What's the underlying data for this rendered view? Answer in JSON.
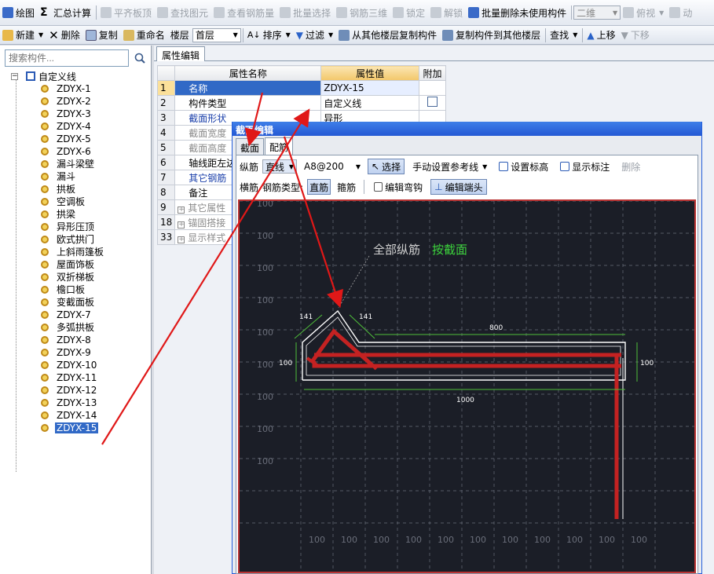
{
  "toolbar1": [
    {
      "label": "绘图",
      "icon": "draw-icon",
      "disabled": false
    },
    {
      "label": "汇总计算",
      "icon": "sigma-icon",
      "disabled": false
    },
    {
      "label": "平齐板顶",
      "icon": "align-top-icon",
      "disabled": true
    },
    {
      "label": "查找图元",
      "icon": "find-element-icon",
      "disabled": true
    },
    {
      "label": "查看钢筋量",
      "icon": "rebar-quantity-icon",
      "disabled": true
    },
    {
      "label": "批量选择",
      "icon": "batch-select-icon",
      "disabled": true
    },
    {
      "label": "钢筋三维",
      "icon": "rebar-3d-icon",
      "disabled": true
    },
    {
      "label": "锁定",
      "icon": "lock-icon",
      "disabled": true
    },
    {
      "label": "解锁",
      "icon": "unlock-icon",
      "disabled": true
    },
    {
      "label": "批量删除未使用构件",
      "icon": "batch-delete-icon",
      "disabled": false
    }
  ],
  "view_combo": "二维",
  "view_toolbar": [
    {
      "label": "俯视",
      "icon": "top-view-icon"
    },
    {
      "label": "动",
      "icon": "orbit-icon"
    }
  ],
  "toolbar2": {
    "new": "新建",
    "delete": "删除",
    "copy": "复制",
    "rename": "重命名",
    "floor_label": "楼层",
    "floor_value": "首层",
    "sort": "排序",
    "filter": "过滤",
    "copy_from": "从其他楼层复制构件",
    "copy_to": "复制构件到其他楼层",
    "find": "查找",
    "move_up": "上移",
    "move_down": "下移"
  },
  "search_placeholder": "搜索构件...",
  "tree": {
    "root": "自定义线",
    "items": [
      "ZDYX-1",
      "ZDYX-2",
      "ZDYX-3",
      "ZDYX-4",
      "ZDYX-5",
      "ZDYX-6",
      "漏斗梁壁",
      "漏斗",
      "拱板",
      "空调板",
      "拱梁",
      "异形压顶",
      "欧式拱门",
      "上斜雨篷板",
      "屋面饰板",
      "双折梯板",
      "檐口板",
      "变截面板",
      "ZDYX-7",
      "多弧拱板",
      "ZDYX-8",
      "ZDYX-9",
      "ZDYX-10",
      "ZDYX-11",
      "ZDYX-12",
      "ZDYX-13",
      "ZDYX-14",
      "ZDYX-15"
    ],
    "selected": "ZDYX-15"
  },
  "prop_tab": "属性编辑",
  "prop_table": {
    "headers": [
      "属性名称",
      "属性值",
      "附加"
    ],
    "rows": [
      {
        "no": "1",
        "name": "名称",
        "value": "ZDYX-15",
        "style": "blue",
        "selected": true,
        "check": false,
        "expand": false
      },
      {
        "no": "2",
        "name": "构件类型",
        "value": "自定义线",
        "style": "normal",
        "selected": false,
        "check": true,
        "expand": false
      },
      {
        "no": "3",
        "name": "截面形状",
        "value": "异形",
        "style": "blue",
        "selected": false,
        "check": false,
        "expand": false
      },
      {
        "no": "4",
        "name": "截面宽度",
        "value": "",
        "style": "gray",
        "selected": false,
        "check": false,
        "expand": false
      },
      {
        "no": "5",
        "name": "截面高度",
        "value": "",
        "style": "gray",
        "selected": false,
        "check": false,
        "expand": false
      },
      {
        "no": "6",
        "name": "轴线距左边",
        "value": "",
        "style": "normal",
        "selected": false,
        "check": false,
        "expand": false
      },
      {
        "no": "7",
        "name": "其它钢筋",
        "value": "",
        "style": "blue",
        "selected": false,
        "check": false,
        "expand": false
      },
      {
        "no": "8",
        "name": "备注",
        "value": "",
        "style": "normal",
        "selected": false,
        "check": false,
        "expand": false
      },
      {
        "no": "9",
        "name": "其它属性",
        "value": "",
        "style": "gray",
        "selected": false,
        "check": false,
        "expand": true
      },
      {
        "no": "18",
        "name": "锚固搭接",
        "value": "",
        "style": "gray",
        "selected": false,
        "check": false,
        "expand": true
      },
      {
        "no": "33",
        "name": "显示样式",
        "value": "",
        "style": "gray",
        "selected": false,
        "check": false,
        "expand": true
      }
    ]
  },
  "dialog": {
    "title": "截面编辑",
    "tabs": [
      "截面",
      "配筋"
    ],
    "active_tab": "配筋",
    "row1": {
      "rebar_label": "纵筋",
      "line_mode": "直线",
      "spec": "A8@200",
      "select": "选择",
      "ref_line": "手动设置参考线",
      "set_elev": "设置标高",
      "show_dim": "显示标注",
      "delete": "删除"
    },
    "row2": {
      "transverse": "横筋",
      "type_label": "钢筋类型:",
      "straight": "直筋",
      "stirrup": "箍筋",
      "edit_bend": "编辑弯钩",
      "edit_end": "编辑端头"
    },
    "canvas": {
      "annotation_prefix": "全部纵筋",
      "annotation_value": "按截面",
      "dims": {
        "left1": "141",
        "left2": "141",
        "top": "800",
        "height_left": "100",
        "height_right": "100",
        "bottom": "1000"
      },
      "grid_left_labels": [
        "100",
        "100",
        "100",
        "100",
        "100",
        "100",
        "100",
        "100",
        "100"
      ],
      "grid_bottom_labels": [
        "100",
        "100",
        "100",
        "100",
        "100",
        "100",
        "100",
        "100",
        "100",
        "100",
        "100"
      ],
      "colors": {
        "background": "#1b1e27",
        "rebar": "#c42222",
        "outline": "#ffffff",
        "dimension": "#4fbf3a",
        "grid": "#6a6e7a",
        "annotation_value": "#3cd23c"
      }
    }
  },
  "arrows_color": "#e01818"
}
